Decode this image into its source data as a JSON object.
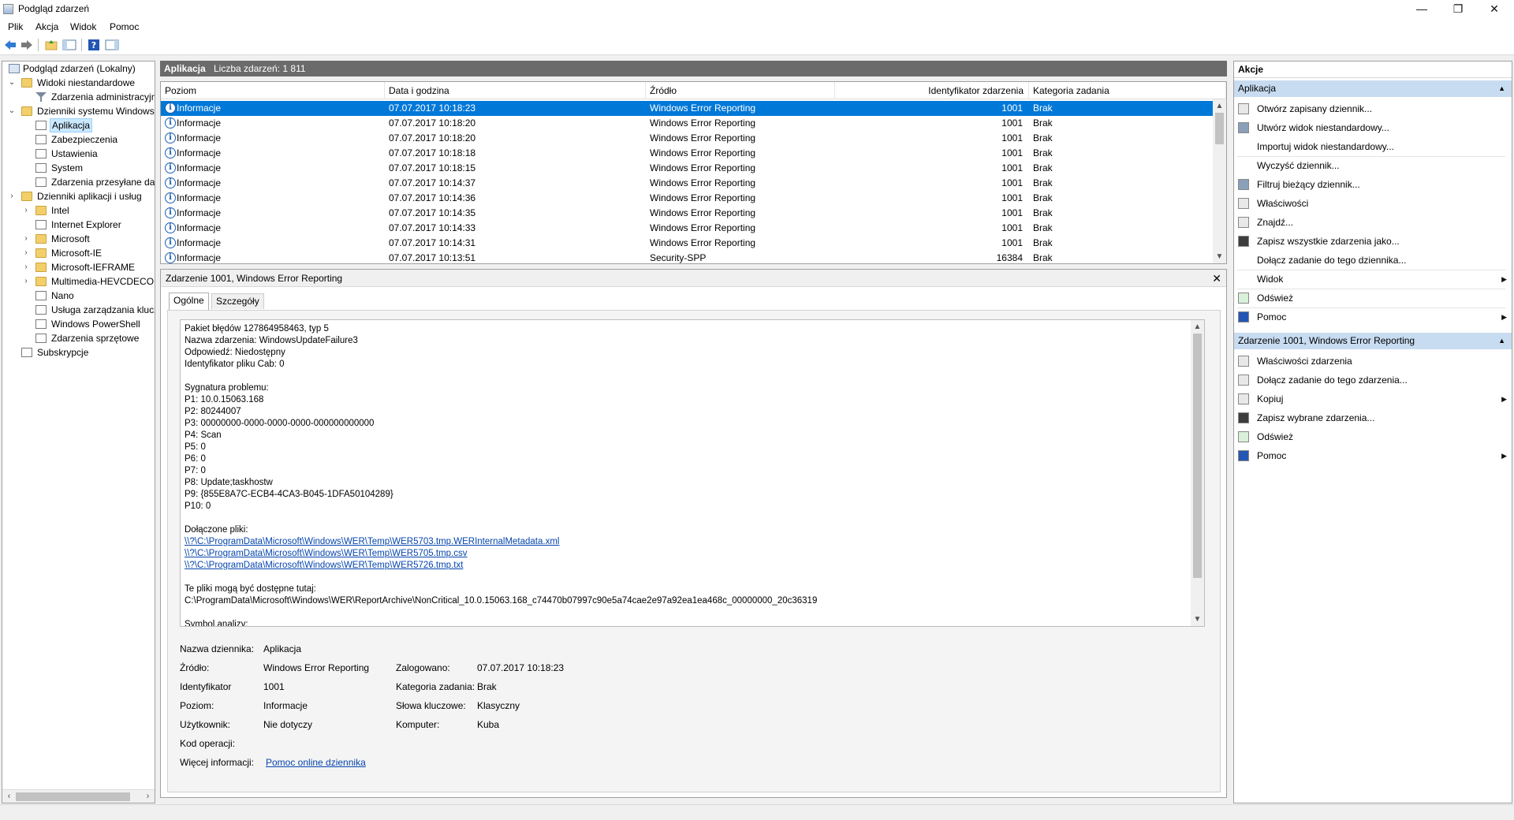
{
  "window": {
    "title": "Podgląd zdarzeń",
    "minimize": "—",
    "maximize": "❐",
    "close": "✕"
  },
  "menu": [
    "Plik",
    "Akcja",
    "Widok",
    "Pomoc"
  ],
  "tree": {
    "root": "Podgląd zdarzeń (Lokalny)",
    "custom_views": "Widoki niestandardowe",
    "admin_events": "Zdarzenia administracyjne",
    "windows_logs": "Dzienniki systemu Windows",
    "windows_logs_items": [
      "Aplikacja",
      "Zabezpieczenia",
      "Ustawienia",
      "System",
      "Zdarzenia przesyłane dalej"
    ],
    "app_logs": "Dzienniki aplikacji i usług",
    "app_logs_items": [
      "Intel",
      "Internet Explorer",
      "Microsoft",
      "Microsoft-IE",
      "Microsoft-IEFRAME",
      "Multimedia-HEVCDECODER",
      "Nano",
      "Usługa zarządzania kluczami",
      "Windows PowerShell",
      "Zdarzenia sprzętowe"
    ],
    "subscriptions": "Subskrypcje"
  },
  "log_header": {
    "name": "Aplikacja",
    "count": "Liczba zdarzeń: 1 811"
  },
  "columns": [
    "Poziom",
    "Data i godzina",
    "Źródło",
    "Identyfikator zdarzenia",
    "Kategoria zadania"
  ],
  "events": [
    {
      "level": "Informacje",
      "date": "07.07.2017 10:18:23",
      "source": "Windows Error Reporting",
      "id": "1001",
      "category": "Brak"
    },
    {
      "level": "Informacje",
      "date": "07.07.2017 10:18:20",
      "source": "Windows Error Reporting",
      "id": "1001",
      "category": "Brak"
    },
    {
      "level": "Informacje",
      "date": "07.07.2017 10:18:20",
      "source": "Windows Error Reporting",
      "id": "1001",
      "category": "Brak"
    },
    {
      "level": "Informacje",
      "date": "07.07.2017 10:18:18",
      "source": "Windows Error Reporting",
      "id": "1001",
      "category": "Brak"
    },
    {
      "level": "Informacje",
      "date": "07.07.2017 10:18:15",
      "source": "Windows Error Reporting",
      "id": "1001",
      "category": "Brak"
    },
    {
      "level": "Informacje",
      "date": "07.07.2017 10:14:37",
      "source": "Windows Error Reporting",
      "id": "1001",
      "category": "Brak"
    },
    {
      "level": "Informacje",
      "date": "07.07.2017 10:14:36",
      "source": "Windows Error Reporting",
      "id": "1001",
      "category": "Brak"
    },
    {
      "level": "Informacje",
      "date": "07.07.2017 10:14:35",
      "source": "Windows Error Reporting",
      "id": "1001",
      "category": "Brak"
    },
    {
      "level": "Informacje",
      "date": "07.07.2017 10:14:33",
      "source": "Windows Error Reporting",
      "id": "1001",
      "category": "Brak"
    },
    {
      "level": "Informacje",
      "date": "07.07.2017 10:14:31",
      "source": "Windows Error Reporting",
      "id": "1001",
      "category": "Brak"
    },
    {
      "level": "Informacje",
      "date": "07.07.2017 10:13:51",
      "source": "Security-SPP",
      "id": "16384",
      "category": "Brak"
    }
  ],
  "detail": {
    "title": "Zdarzenie 1001, Windows Error Reporting",
    "tabs": [
      "Ogólne",
      "Szczegóły"
    ],
    "description": [
      "Pakiet błędów 127864958463, typ 5",
      "Nazwa zdarzenia: WindowsUpdateFailure3",
      "Odpowiedź: Niedostępny",
      "Identyfikator pliku Cab: 0",
      "",
      "Sygnatura problemu:",
      "P1: 10.0.15063.168",
      "P2: 80244007",
      "P3: 00000000-0000-0000-0000-000000000000",
      "P4: Scan",
      "P5: 0",
      "P6: 0",
      "P7: 0",
      "P8: Update;taskhostw",
      "P9: {855E8A7C-ECB4-4CA3-B045-1DFA50104289}",
      "P10: 0",
      "",
      "Dołączone pliki:",
      "\\\\?\\C:\\ProgramData\\Microsoft\\Windows\\WER\\Temp\\WER5703.tmp.WERInternalMetadata.xml",
      "\\\\?\\C:\\ProgramData\\Microsoft\\Windows\\WER\\Temp\\WER5705.tmp.csv",
      "\\\\?\\C:\\ProgramData\\Microsoft\\Windows\\WER\\Temp\\WER5726.tmp.txt",
      "",
      "Te pliki mogą być dostępne tutaj:",
      "C:\\ProgramData\\Microsoft\\Windows\\WER\\ReportArchive\\NonCritical_10.0.15063.168_c74470b07997c90e5a74cae2e97a92ea1ea468c_00000000_20c36319",
      "",
      "Symbol analizy:"
    ],
    "labels": {
      "log_name": "Nazwa dziennika:",
      "source": "Źródło:",
      "logged": "Zalogowano:",
      "id": "Identyfikator",
      "category": "Kategoria zadania:",
      "level": "Poziom:",
      "keywords": "Słowa kluczowe:",
      "user": "Użytkownik:",
      "computer": "Komputer:",
      "opcode": "Kod operacji:",
      "more_info": "Więcej informacji:"
    },
    "values": {
      "log_name": "Aplikacja",
      "source": "Windows Error Reporting",
      "logged": "07.07.2017 10:18:23",
      "id": "1001",
      "category": "Brak",
      "level": "Informacje",
      "keywords": "Klasyczny",
      "user": "Nie dotyczy",
      "computer": "Kuba",
      "more_info_link": "Pomoc online dziennika"
    }
  },
  "actions": {
    "title": "Akcje",
    "section1": "Aplikacja",
    "section1_items": [
      "Otwórz zapisany dziennik...",
      "Utwórz widok niestandardowy...",
      "Importuj widok niestandardowy...",
      "Wyczyść dziennik...",
      "Filtruj bieżący dziennik...",
      "Właściwości",
      "Znajdź...",
      "Zapisz wszystkie zdarzenia jako...",
      "Dołącz zadanie do tego dziennika...",
      "Widok",
      "Odśwież",
      "Pomoc"
    ],
    "section2": "Zdarzenie 1001, Windows Error Reporting",
    "section2_items": [
      "Właściwości zdarzenia",
      "Dołącz zadanie do tego zdarzenia...",
      "Kopiuj",
      "Zapisz wybrane zdarzenia...",
      "Odśwież",
      "Pomoc"
    ]
  }
}
